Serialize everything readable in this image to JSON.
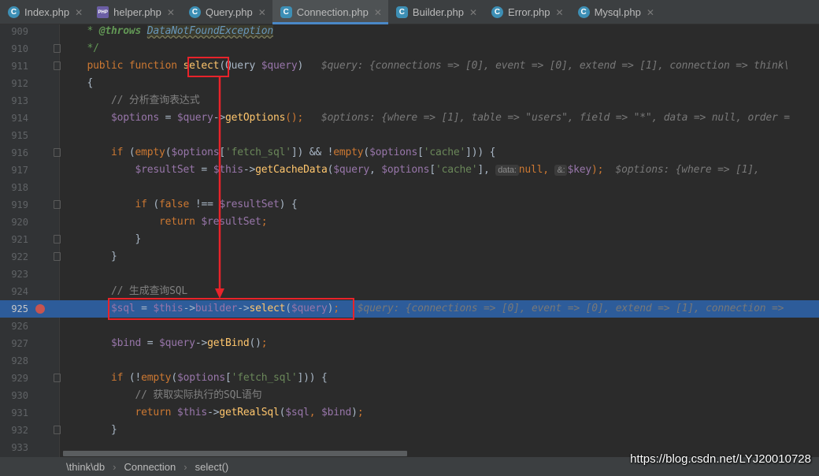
{
  "tabs": [
    {
      "label": "Index.php",
      "icon": "c"
    },
    {
      "label": "helper.php",
      "icon": "php"
    },
    {
      "label": "Query.php",
      "icon": "c"
    },
    {
      "label": "Connection.php",
      "icon": "cls",
      "active": true
    },
    {
      "label": "Builder.php",
      "icon": "cls"
    },
    {
      "label": "Error.php",
      "icon": "c"
    },
    {
      "label": "Mysql.php",
      "icon": "c"
    }
  ],
  "lines": [
    {
      "n": "909",
      "t": [
        [
          "doc",
          "    * "
        ],
        [
          "doct",
          "@throws"
        ],
        [
          "doc",
          " "
        ],
        [
          "docc",
          "DataNotFoundException"
        ]
      ]
    },
    {
      "n": "910",
      "fold": true,
      "t": [
        [
          "doc",
          "    */"
        ]
      ]
    },
    {
      "n": "911",
      "fold": true,
      "t": [
        [
          "kw",
          "    public function "
        ],
        [
          "fn",
          "select"
        ],
        [
          "",
          "(Query "
        ],
        [
          "var",
          "$query"
        ],
        [
          "",
          ")  "
        ],
        [
          "hint",
          " $query: {connections => [0], event => [0], extend => [1], connection => think\\"
        ]
      ]
    },
    {
      "n": "912",
      "t": [
        [
          "",
          "    {"
        ]
      ]
    },
    {
      "n": "913",
      "t": [
        [
          "cm",
          "        // 分析查询表达式"
        ]
      ]
    },
    {
      "n": "914",
      "t": [
        [
          "var",
          "        $options"
        ],
        [
          "",
          " = "
        ],
        [
          "var",
          "$query"
        ],
        [
          "",
          "->"
        ],
        [
          "fn",
          "getOptions"
        ],
        [
          "kw",
          "();"
        ],
        [
          "hint",
          "   $options: {where => [1], table => \"users\", field => \"*\", data => null, order = "
        ]
      ]
    },
    {
      "n": "915",
      "t": []
    },
    {
      "n": "916",
      "fold": true,
      "t": [
        [
          "kw",
          "        if "
        ],
        [
          "",
          "("
        ],
        [
          "kw",
          "empty"
        ],
        [
          "",
          "("
        ],
        [
          "var",
          "$options"
        ],
        [
          "",
          "["
        ],
        [
          "str",
          "'fetch_sql'"
        ],
        [
          "",
          "]) && !"
        ],
        [
          "kw",
          "empty"
        ],
        [
          "",
          "("
        ],
        [
          "var",
          "$options"
        ],
        [
          "",
          "["
        ],
        [
          "str",
          "'cache'"
        ],
        [
          "",
          "])) {"
        ]
      ]
    },
    {
      "n": "917",
      "t": [
        [
          "var",
          "            $resultSet"
        ],
        [
          "",
          " = "
        ],
        [
          "var",
          "$this"
        ],
        [
          "",
          "->"
        ],
        [
          "fn",
          "getCacheData"
        ],
        [
          "",
          "("
        ],
        [
          "var",
          "$query"
        ],
        [
          "",
          ", "
        ],
        [
          "var",
          "$options"
        ],
        [
          "",
          "["
        ],
        [
          "str",
          "'cache'"
        ],
        [
          "",
          "], "
        ],
        [
          "param",
          "data:"
        ],
        [
          "kw",
          "null, "
        ],
        [
          "param",
          "&:"
        ],
        [
          "var",
          "$key"
        ],
        [
          "kw",
          ");"
        ],
        [
          "hint",
          "  $options: {where => [1], "
        ]
      ]
    },
    {
      "n": "918",
      "t": []
    },
    {
      "n": "919",
      "fold": true,
      "t": [
        [
          "kw",
          "            if "
        ],
        [
          "",
          "("
        ],
        [
          "kw",
          "false"
        ],
        [
          "",
          " !== "
        ],
        [
          "var",
          "$resultSet"
        ],
        [
          "",
          ") {"
        ]
      ]
    },
    {
      "n": "920",
      "t": [
        [
          "kw",
          "                return "
        ],
        [
          "var",
          "$resultSet"
        ],
        [
          "kw",
          ";"
        ]
      ]
    },
    {
      "n": "921",
      "fold": true,
      "t": [
        [
          "",
          "            }"
        ]
      ]
    },
    {
      "n": "922",
      "fold": true,
      "t": [
        [
          "",
          "        }"
        ]
      ]
    },
    {
      "n": "923",
      "t": []
    },
    {
      "n": "924",
      "t": [
        [
          "cm",
          "        // 生成查询SQL"
        ]
      ]
    },
    {
      "n": "925",
      "hl": true,
      "bp": true,
      "t": [
        [
          "var",
          "        $sql"
        ],
        [
          "",
          " = "
        ],
        [
          "var",
          "$this"
        ],
        [
          "",
          "->"
        ],
        [
          "var",
          "builder"
        ],
        [
          "",
          "->"
        ],
        [
          "fn",
          "select"
        ],
        [
          "",
          "("
        ],
        [
          "var",
          "$query"
        ],
        [
          "",
          ")"
        ],
        [
          "kw",
          ";"
        ],
        [
          "hint",
          "   $query: {connections => [0], event => [0], extend => [1], connection => "
        ]
      ]
    },
    {
      "n": "926",
      "t": []
    },
    {
      "n": "927",
      "t": [
        [
          "var",
          "        $bind"
        ],
        [
          "",
          " = "
        ],
        [
          "var",
          "$query"
        ],
        [
          "",
          "->"
        ],
        [
          "fn",
          "getBind"
        ],
        [
          "",
          "()"
        ],
        [
          "kw",
          ";"
        ]
      ]
    },
    {
      "n": "928",
      "t": []
    },
    {
      "n": "929",
      "fold": true,
      "t": [
        [
          "kw",
          "        if "
        ],
        [
          "",
          "(!"
        ],
        [
          "kw",
          "empty"
        ],
        [
          "",
          "("
        ],
        [
          "var",
          "$options"
        ],
        [
          "",
          "["
        ],
        [
          "str",
          "'fetch_sql'"
        ],
        [
          "",
          "])) {"
        ]
      ]
    },
    {
      "n": "930",
      "t": [
        [
          "cm",
          "            // 获取实际执行的SQL语句"
        ]
      ]
    },
    {
      "n": "931",
      "t": [
        [
          "kw",
          "            return "
        ],
        [
          "var",
          "$this"
        ],
        [
          "",
          "->"
        ],
        [
          "fn",
          "getRealSql"
        ],
        [
          "",
          "("
        ],
        [
          "var",
          "$sql"
        ],
        [
          "kw",
          ", "
        ],
        [
          "var",
          "$bind"
        ],
        [
          "",
          ")"
        ],
        [
          "kw",
          ";"
        ]
      ]
    },
    {
      "n": "932",
      "fold": true,
      "t": [
        [
          "",
          "        }"
        ]
      ]
    },
    {
      "n": "933",
      "t": []
    }
  ],
  "breadcrumb": [
    "\\think\\db",
    "Connection",
    "select()"
  ],
  "watermark": "https://blog.csdn.net/LYJ20010728",
  "colors": {
    "annotation": "#e8232a",
    "highlight_line": "#2d5c9a",
    "breakpoint": "#c75450"
  }
}
